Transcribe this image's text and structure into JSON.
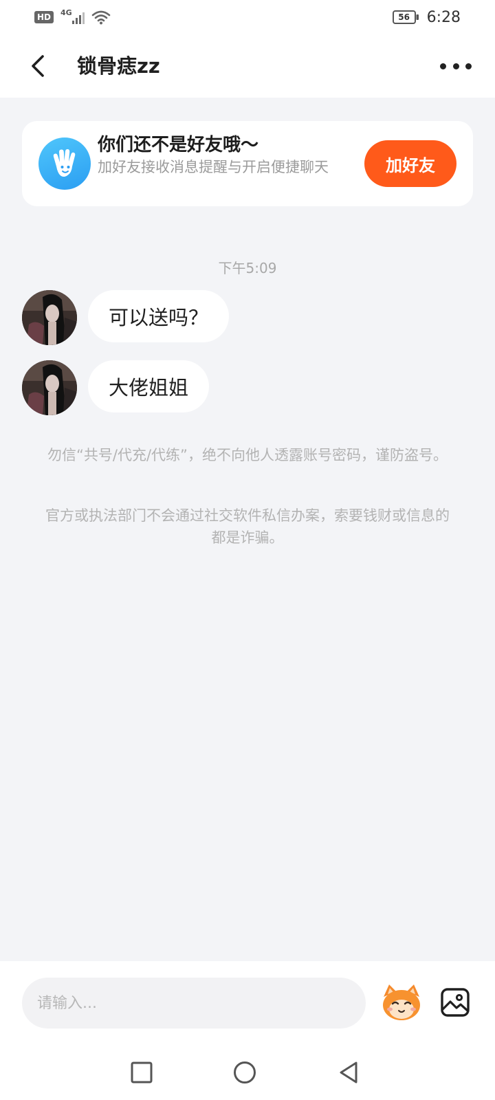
{
  "status_bar": {
    "hd_label": "HD",
    "network_label": "4G",
    "battery_level": "56",
    "time": "6:28"
  },
  "header": {
    "title": "锁骨痣zz"
  },
  "friend_banner": {
    "title": "你们还不是好友哦～",
    "subtitle": "加好友接收消息提醒与开启便捷聊天",
    "add_button_label": "加好友"
  },
  "chat": {
    "timestamp": "下午5:09",
    "messages": [
      {
        "text": "可以送吗？"
      },
      {
        "text": "大佬姐姐"
      }
    ],
    "notices": [
      "勿信“共号/代充/代练”，绝不向他人透露账号密码，谨防盗号。",
      "官方或执法部门不会通过社交软件私信办案，索要钱财或信息的都是诈骗。"
    ]
  },
  "input_bar": {
    "placeholder": "请输入..."
  },
  "icons": {
    "back": "chevron-left-icon",
    "more": "more-dots-icon",
    "wave": "waving-hand-icon",
    "emoji": "mascot-emoji-icon",
    "image": "image-picker-icon"
  },
  "colors": {
    "accent": "#ff5a1a",
    "banner_icon": "#2b9ef2",
    "background": "#f3f4f7"
  }
}
